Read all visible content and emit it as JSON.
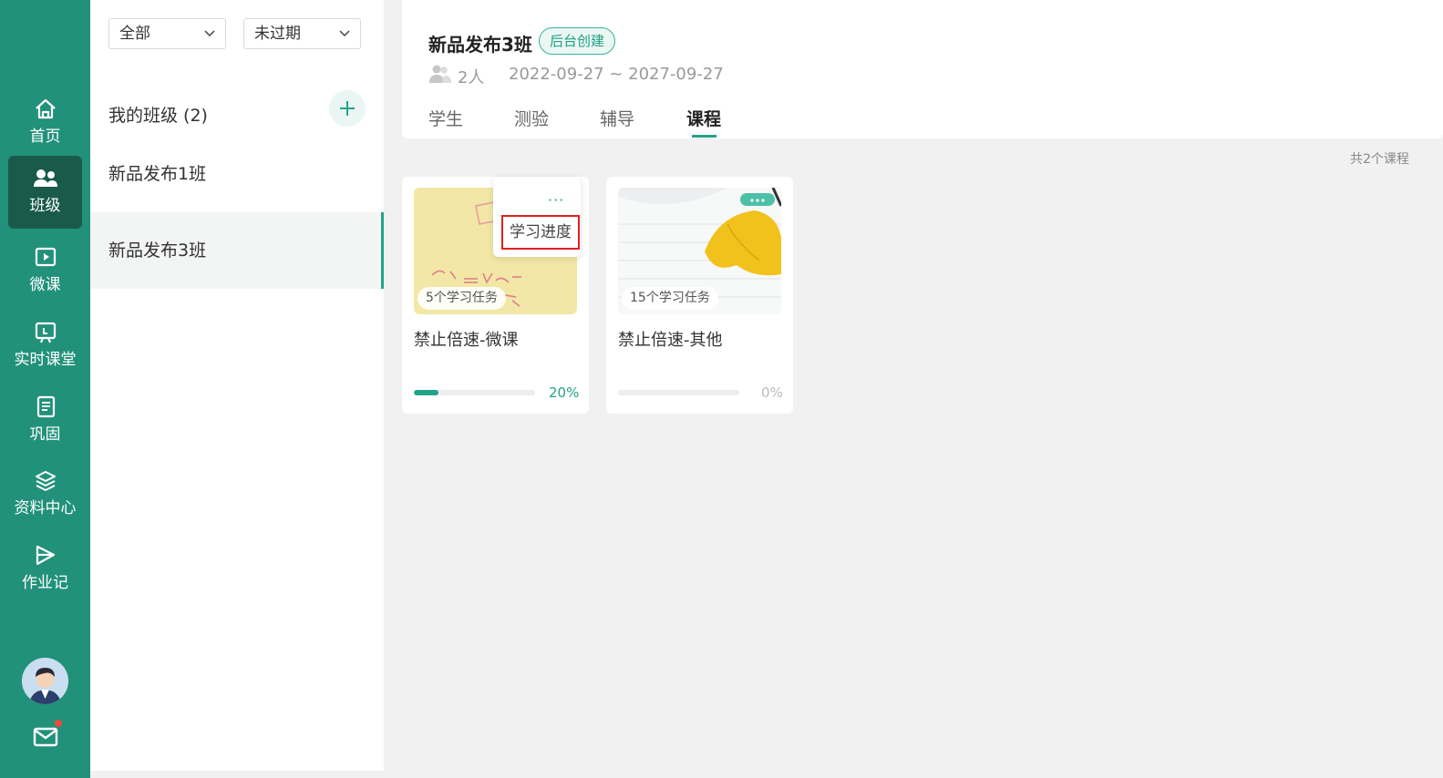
{
  "nav": {
    "items": [
      {
        "label": "首页",
        "icon": "home-icon"
      },
      {
        "label": "班级",
        "icon": "class-people-icon"
      },
      {
        "label": "微课",
        "icon": "micro-course-icon"
      },
      {
        "label": "实时课堂",
        "icon": "live-class-icon"
      },
      {
        "label": "巩固",
        "icon": "notebook-icon"
      },
      {
        "label": "资料中心",
        "icon": "layers-icon"
      },
      {
        "label": "作业记",
        "icon": "homework-icon"
      }
    ],
    "active_index": 1
  },
  "filters": {
    "scope": "全部",
    "status": "未过期"
  },
  "class_list": {
    "heading": "我的班级 (2)",
    "items": [
      "新品发布1班",
      "新品发布3班"
    ],
    "active_index": 1
  },
  "header": {
    "title": "新品发布3班",
    "badge": "后台创建",
    "people": "2人",
    "dates": "2022-09-27 ~ 2027-09-27",
    "tabs": [
      "学生",
      "测验",
      "辅导",
      "课程"
    ],
    "active_tab": 3
  },
  "course_total": "共2个课程",
  "courses": [
    {
      "title": "禁止倍速-微课",
      "tasks": "5个学习任务",
      "progress": 0.2,
      "percent": "20%"
    },
    {
      "title": "禁止倍速-其他",
      "tasks": "15个学习任务",
      "progress": 0,
      "percent": "0%"
    }
  ],
  "popover": {
    "dots": "···",
    "item": "学习进度"
  },
  "colors": {
    "brand": "#22917a",
    "accent": "#22a389",
    "alert_dot": "#f04a3a"
  }
}
